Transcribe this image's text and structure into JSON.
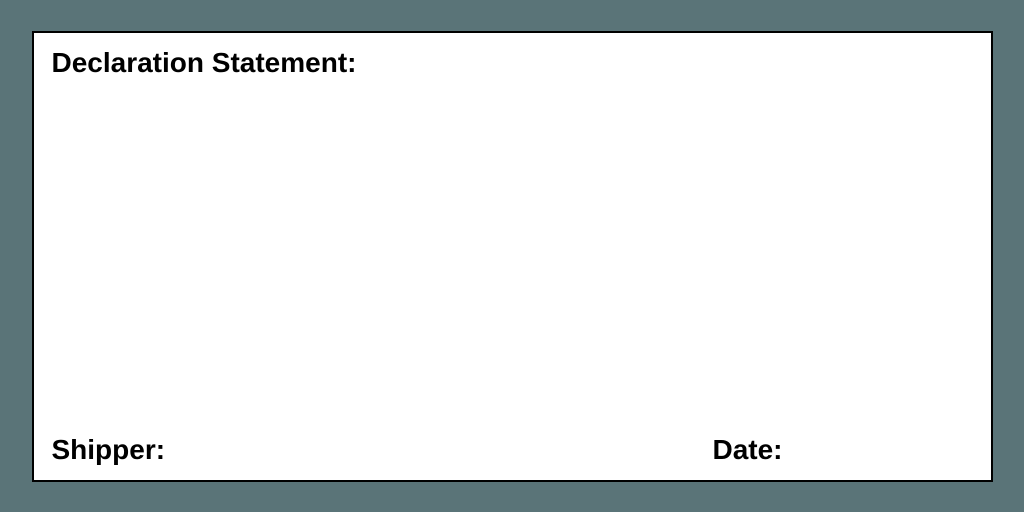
{
  "form": {
    "declaration_label": "Declaration Statement:",
    "shipper_label": "Shipper:",
    "date_label": "Date:"
  }
}
